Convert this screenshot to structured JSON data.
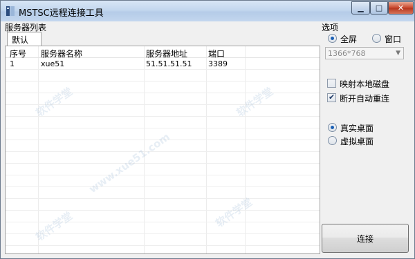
{
  "window": {
    "title": "MSTSC远程连接工具"
  },
  "server_list": {
    "label": "服务器列表",
    "tabs": [
      {
        "label": "默认"
      }
    ],
    "columns": [
      "序号",
      "服务器名称",
      "服务器地址",
      "端口"
    ],
    "rows": [
      {
        "index": "1",
        "name": "xue51",
        "address": "51.51.51.51",
        "port": "3389"
      }
    ]
  },
  "options": {
    "label": "选项",
    "display_mode": {
      "fullscreen": "全屏",
      "window": "窗口",
      "selected": "fullscreen"
    },
    "resolution": {
      "value": "1366*768"
    },
    "map_local_disk": {
      "label": "映射本地磁盘",
      "checked": false
    },
    "auto_reconnect": {
      "label": "断开自动重连",
      "checked": true
    },
    "desktop": {
      "real": "真实桌面",
      "virtual": "虚拟桌面",
      "selected": "real"
    },
    "connect_button": "连接"
  },
  "watermark": {
    "text1": "www.xue51.com",
    "text2": "软件学堂"
  },
  "colors": {
    "titlebar": "#c3d7ee",
    "close": "#c9452a",
    "accent": "#1a5fb4"
  }
}
